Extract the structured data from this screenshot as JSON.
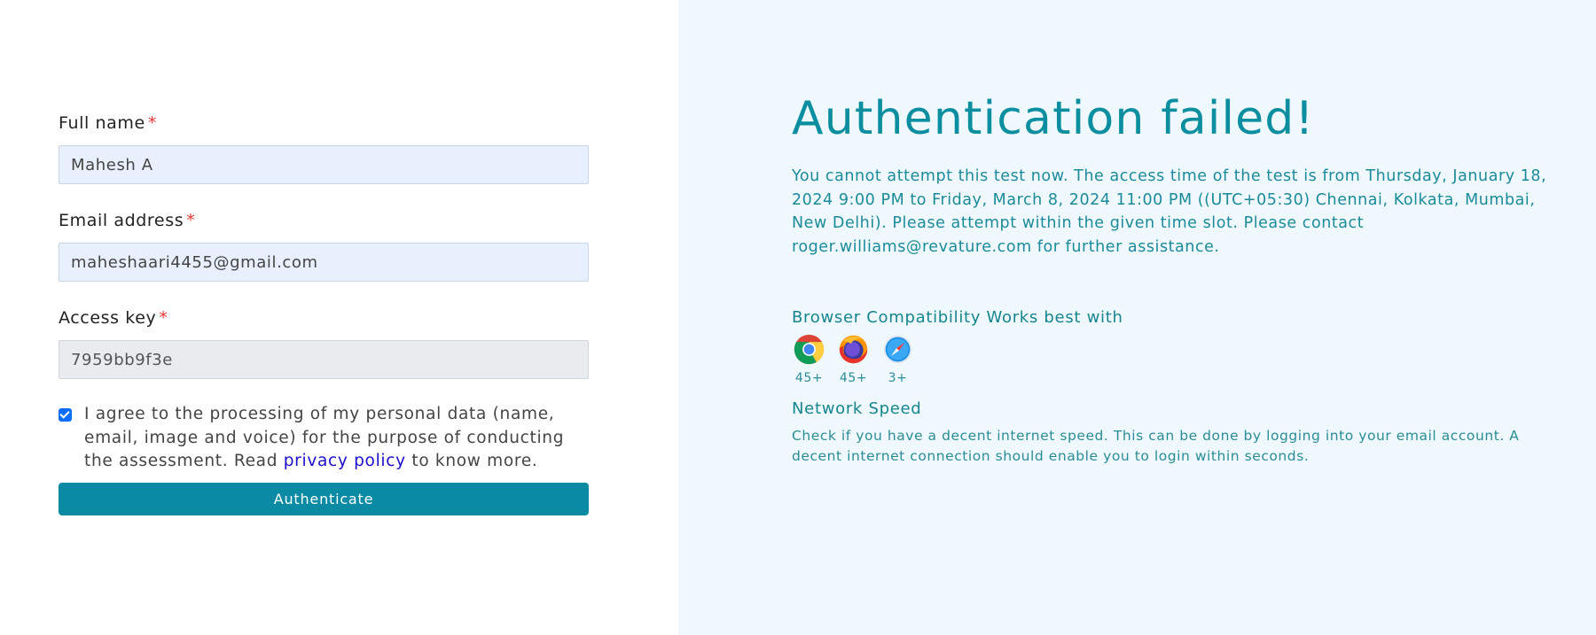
{
  "form": {
    "full_name": {
      "label": "Full name",
      "required_mark": "*",
      "value": "Mahesh A"
    },
    "email": {
      "label": "Email address",
      "required_mark": "*",
      "value": "maheshaari4455@gmail.com"
    },
    "access_key": {
      "label": "Access key",
      "required_mark": "*",
      "value": "7959bb9f3e"
    },
    "consent": {
      "checked": true,
      "text_before": "I agree to the processing of my personal data (name, email, image and voice) for the purpose of conducting the assessment. Read ",
      "link_text": "privacy policy",
      "text_after": " to know more."
    },
    "submit_label": "Authenticate"
  },
  "status": {
    "title": "Authentication failed!",
    "message": "You cannot attempt this test now. The access time of the test is from Thursday, January 18, 2024 9:00 PM to Friday, March 8, 2024 11:00 PM ((UTC+05:30) Chennai, Kolkata, Mumbai, New Delhi). Please attempt within the given time slot. Please contact roger.williams@revature.com for further assistance."
  },
  "compatibility": {
    "title": "Browser Compatibility Works best with",
    "browsers": [
      {
        "icon": "chrome-icon",
        "version": "45+"
      },
      {
        "icon": "firefox-icon",
        "version": "45+"
      },
      {
        "icon": "safari-icon",
        "version": "3+"
      }
    ]
  },
  "network": {
    "title": "Network Speed",
    "text": "Check if you have a decent internet speed. This can be done by logging into your email account. A decent internet connection should enable you to login within seconds."
  },
  "colors": {
    "accent": "#0a8ba3",
    "right_panel_bg": "#eff9fd",
    "input_bg": "#e8f0fe",
    "required": "#e53935",
    "link": "#1a0dcc"
  }
}
